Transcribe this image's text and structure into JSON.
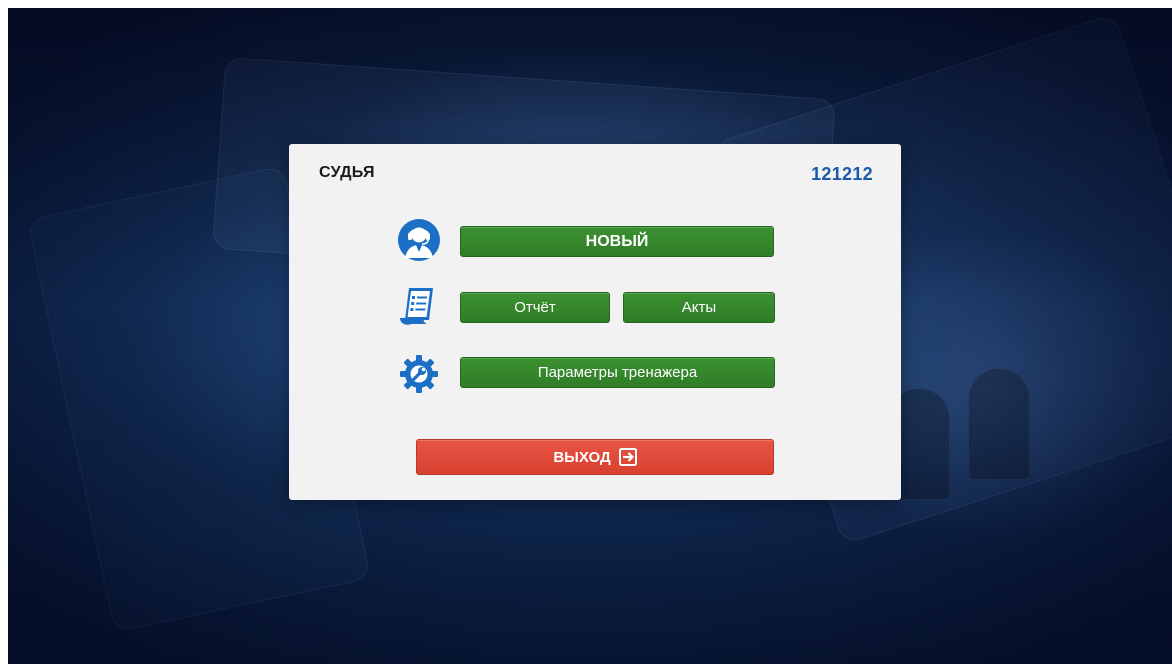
{
  "dialog": {
    "title": "СУДЬЯ",
    "id_value": "121212"
  },
  "menu": {
    "new_label": "НОВЫЙ",
    "report_label": "Отчёт",
    "acts_label": "Акты",
    "params_label": "Параметры тренажера",
    "exit_label": "ВЫХОД"
  },
  "icons": {
    "user": "operator-headset-icon",
    "report": "document-list-icon",
    "settings": "gear-wrench-icon",
    "exit": "exit-arrow-icon"
  },
  "colors": {
    "accent_blue": "#1b5aa8",
    "button_green": "#2f7d27",
    "button_red": "#d8402f",
    "dialog_bg": "#f2f2f2"
  }
}
